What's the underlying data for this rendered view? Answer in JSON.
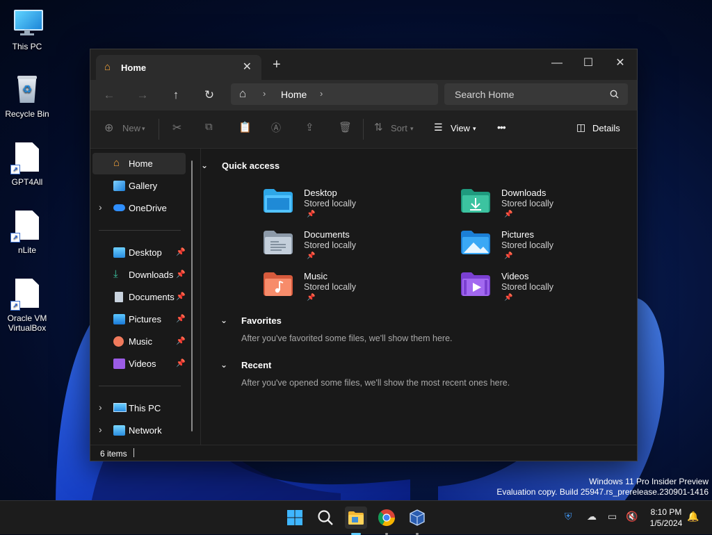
{
  "desktop": {
    "icons": [
      {
        "label": "This PC"
      },
      {
        "label": "Recycle Bin"
      },
      {
        "label": "GPT4All"
      },
      {
        "label": "nLite"
      },
      {
        "label": "Oracle VM VirtualBox"
      }
    ]
  },
  "window": {
    "tab_title": "Home",
    "new_tab_symbol": "+",
    "controls": {
      "minimize": "—",
      "maximize": "☐",
      "close": "✕"
    },
    "address": {
      "path_item": "Home"
    },
    "search_placeholder": "Search Home",
    "commands": {
      "new": "New",
      "sort": "Sort",
      "view": "View",
      "more": "•••",
      "details": "Details"
    },
    "nav": {
      "home": "Home",
      "gallery": "Gallery",
      "onedrive": "OneDrive",
      "pinned": [
        {
          "label": "Desktop"
        },
        {
          "label": "Downloads"
        },
        {
          "label": "Documents"
        },
        {
          "label": "Pictures"
        },
        {
          "label": "Music"
        },
        {
          "label": "Videos"
        }
      ],
      "this_pc": "This PC",
      "network": "Network"
    },
    "quick_access": {
      "title": "Quick access",
      "items": [
        {
          "name": "Desktop",
          "sub": "Stored locally"
        },
        {
          "name": "Downloads",
          "sub": "Stored locally"
        },
        {
          "name": "Documents",
          "sub": "Stored locally"
        },
        {
          "name": "Pictures",
          "sub": "Stored locally"
        },
        {
          "name": "Music",
          "sub": "Stored locally"
        },
        {
          "name": "Videos",
          "sub": "Stored locally"
        }
      ]
    },
    "favorites": {
      "title": "Favorites",
      "empty_text": "After you've favorited some files, we'll show them here."
    },
    "recent": {
      "title": "Recent",
      "empty_text": "After you've opened some files, we'll show the most recent ones here."
    },
    "status": "6 items"
  },
  "watermark": {
    "line1": "Windows 11 Pro Insider Preview",
    "line2": "Evaluation copy. Build 25947.rs_prerelease.230901-1416"
  },
  "taskbar": {
    "time": "8:10 PM",
    "date": "1/5/2024"
  },
  "colors": {
    "accent": "#60cdff",
    "window_bg": "#191919",
    "titlebar_bg": "#202020"
  }
}
